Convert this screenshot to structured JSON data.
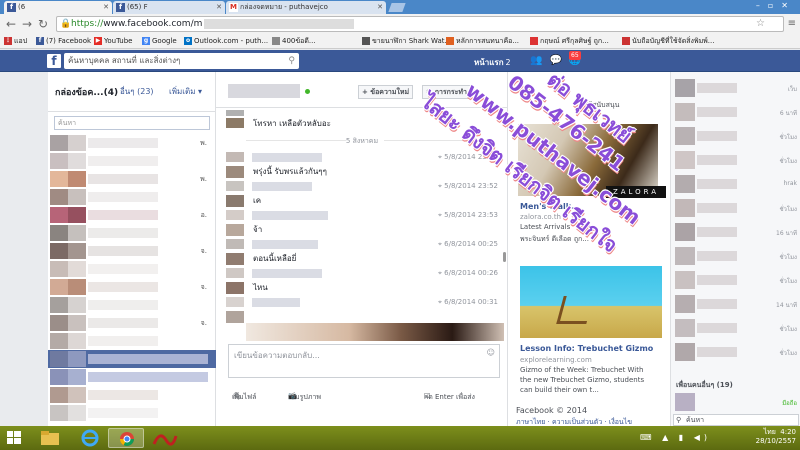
{
  "browser": {
    "tabs": [
      {
        "label": "(6",
        "icon": "facebook-icon"
      },
      {
        "label": "(65) F",
        "icon": "facebook-icon"
      },
      {
        "label": "กล่องจดหมาย - puthavejco",
        "icon": "gmail-icon"
      }
    ],
    "url_scheme": "https://",
    "url_host": "www.facebook.com/m",
    "bookmarks": [
      {
        "label": "แอป",
        "icon": "apps-icon",
        "color": "#c33"
      },
      {
        "label": "(7) Facebook",
        "icon": "facebook-icon",
        "color": "#3b5998"
      },
      {
        "label": "YouTube",
        "icon": "youtube-icon",
        "color": "#e52d27"
      },
      {
        "label": "Google",
        "icon": "google-icon",
        "color": "#4285f4"
      },
      {
        "label": "Outlook.com - puth...",
        "icon": "outlook-icon",
        "color": "#0072c6"
      },
      {
        "label": "400ข้อดี...",
        "icon": "page-icon",
        "color": "#888"
      },
      {
        "label": "ขายนาฬิกา Shark Wat...",
        "icon": "page-icon",
        "color": "#555"
      },
      {
        "label": "หลักการสนทนาคือ...",
        "icon": "page-icon",
        "color": "#e06020"
      },
      {
        "label": "กฤษณ์ ศรีกุลศิษฐ์ ถูก...",
        "icon": "page-icon",
        "color": "#d33"
      },
      {
        "label": "นับถือบัญชีที่ใช้จัดสิ่งพิมพ์...",
        "icon": "page-icon",
        "color": "#c33"
      }
    ]
  },
  "fb": {
    "search_placeholder": "ค้นหาบุคคล สถานที่ และสิ่งต่างๆ",
    "home_label": "หน้าแรก",
    "home_count": "2",
    "notif_badge": "65"
  },
  "left": {
    "inbox_label": "กล่องข้อค...(4)",
    "other_label": "อื่นๆ (23)",
    "more_label": "เพิ่มเติม ▾",
    "search_placeholder": "ค้นหา",
    "convo_letters": [
      "พ.",
      "",
      "พ.",
      "",
      "อ.",
      "",
      "จ.",
      "",
      "จ.",
      "",
      "จ.",
      "",
      "",
      "",
      "",
      ""
    ]
  },
  "thread": {
    "new_message_btn": "+ ข้อความใหม่",
    "actions_btn": "⚙ การกระทำ",
    "top_text": "โทรหา เหลือตัวหลับอะ",
    "date_separator": "5 สิงหาคม",
    "messages": [
      {
        "time": "5/8/2014 23:46",
        "text": "พรุ่งนี้ รับพรแล้วกันๆๆ"
      },
      {
        "time": "5/8/2014 23:52",
        "text": "เค"
      },
      {
        "time": "5/8/2014 23:53",
        "text": "จ้า"
      },
      {
        "time": "6/8/2014 00:25",
        "text": "ตอนนี้เหลือยี่"
      },
      {
        "time": "6/8/2014 00:26",
        "text": "ไหน"
      },
      {
        "time": "6/8/2014 00:31",
        "text": ""
      }
    ],
    "compose_placeholder": "เขียนข้อความตอบกลับ...",
    "add_file": "เพิ่มไฟล์",
    "add_photo": "เพิ่มรูปภาพ",
    "enter_to_send": "กด Enter เพื่อส่ง"
  },
  "ads": {
    "top_partial": "ผู้สนับสนุน",
    "brand_overlay": "ZALORA",
    "ad1_title": "Men's Walk...",
    "ad1_site": "zalora.co.th",
    "ad1_body": "Latest Arrivals",
    "ad1_like": "พระจินทร์ ดีเลือด ถูก...",
    "ad2_title": "Lesson Info: Trebuchet Gizmo",
    "ad2_site": "explorelearning.com",
    "ad2_body": [
      "Gizmo of the Week: Trebuchet With",
      "the new Trebuchet Gizmo, students",
      "can build their own t..."
    ],
    "footer_copyright": "Facebook © 2014",
    "footer_links": "ภาษาไทย · ความเป็นส่วนตัว · เงื่อนไข"
  },
  "chat": {
    "statuses": [
      "เว็บ",
      "6 นาที",
      "ชั่วโมง",
      "ชั่วโมง",
      "hrak",
      "ชั่วโมง",
      "16 นาที",
      "ชั่วโมง",
      "ชั่วโมง",
      "14 นาที",
      "ชั่วโมง",
      "ชั่วโมง",
      "",
      "",
      ""
    ],
    "friends_label": "เพื่อนคนอื่นๆ (19)",
    "mobile_label": "มือถือ",
    "search_placeholder": "ค้นหา"
  },
  "watermark": {
    "line1": "ต่อ พุธเวทย์",
    "line2": "085-476-241",
    "line3": "www.puthavej.com",
    "line4": "ไสยะ ดึงจิต เรียกจิต เรียกใจ"
  },
  "taskbar": {
    "time": "4:20",
    "date": "28/10/2557",
    "lang": "ไทย"
  }
}
